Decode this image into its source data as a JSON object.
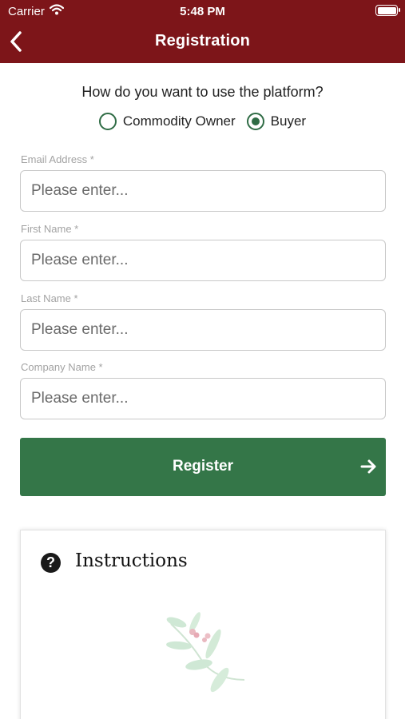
{
  "status_bar": {
    "carrier": "Carrier",
    "time": "5:48 PM"
  },
  "header": {
    "title": "Registration",
    "back_icon": "chevron-left-icon"
  },
  "usage": {
    "question": "How do you want to use the platform?",
    "options": [
      {
        "label": "Commodity Owner",
        "selected": false
      },
      {
        "label": "Buyer",
        "selected": true
      }
    ]
  },
  "form": {
    "fields": [
      {
        "label": "Email Address *",
        "placeholder": "Please enter...",
        "value": ""
      },
      {
        "label": "First Name *",
        "placeholder": "Please enter...",
        "value": ""
      },
      {
        "label": "Last Name *",
        "placeholder": "Please enter...",
        "value": ""
      },
      {
        "label": "Company Name *",
        "placeholder": "Please enter...",
        "value": ""
      }
    ],
    "register_label": "Register",
    "register_icon": "arrow-right-icon"
  },
  "instructions": {
    "title": "Instructions",
    "icon": "help-circle-icon"
  },
  "colors": {
    "header_bg": "#7d1519",
    "accent_green": "#347648",
    "radio_green": "#2e6b44"
  }
}
